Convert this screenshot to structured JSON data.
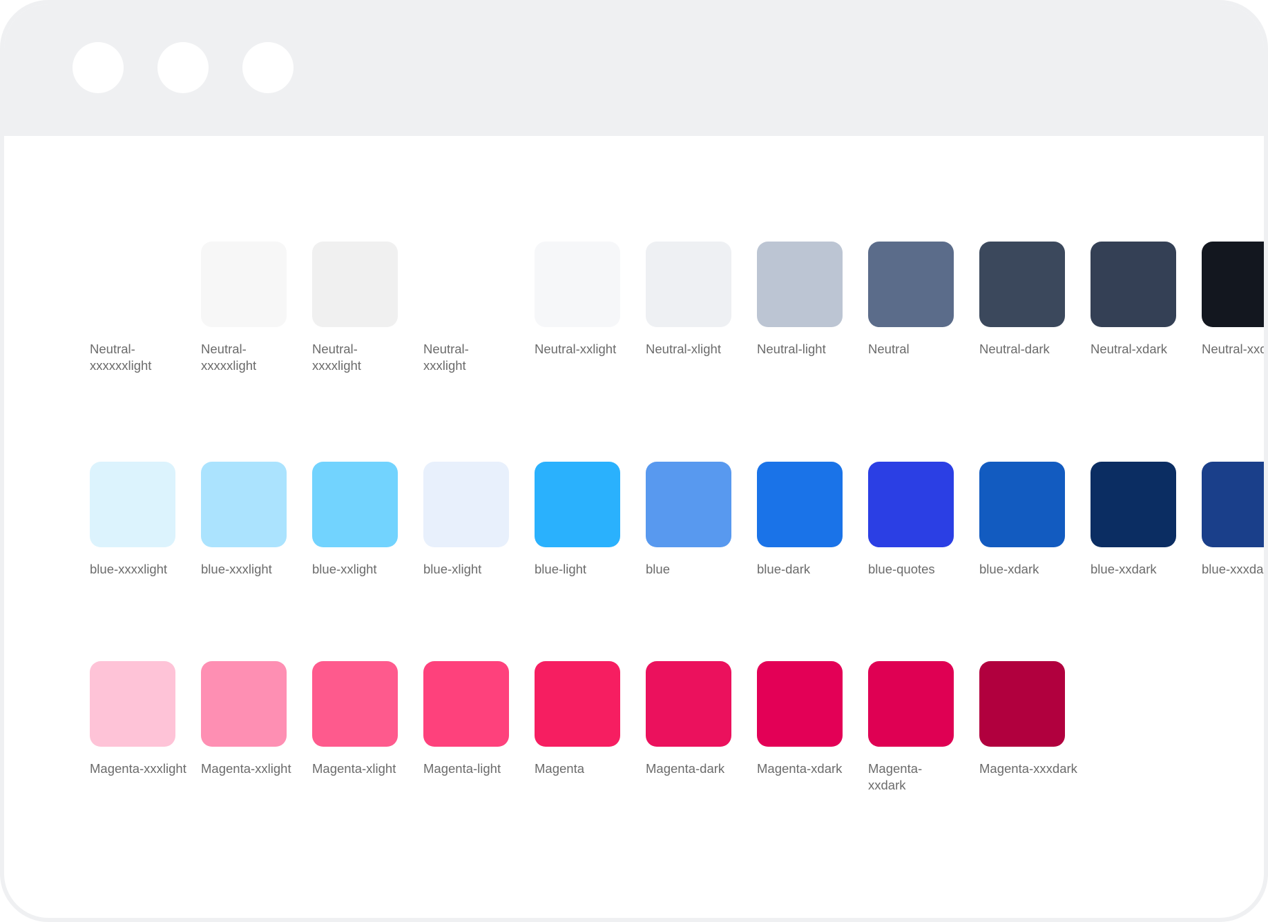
{
  "window": {
    "traffic_lights": [
      "window-dot",
      "window-dot",
      "window-dot"
    ]
  },
  "rows": [
    {
      "name": "Neutral",
      "swatches": [
        {
          "label": "Neutral-xxxxxxlight",
          "color": "#ffffff"
        },
        {
          "label": "Neutral-xxxxxlight",
          "color": "#f7f7f7"
        },
        {
          "label": "Neutral-xxxxlight",
          "color": "#f0f0f0"
        },
        {
          "label": "Neutral-xxxlight",
          "color": "#ffffff"
        },
        {
          "label": "Neutral-xxlight",
          "color": "#f6f7f9"
        },
        {
          "label": "Neutral-xlight",
          "color": "#eef0f3"
        },
        {
          "label": "Neutral-light",
          "color": "#bcc5d3"
        },
        {
          "label": "Neutral",
          "color": "#5b6c8a"
        },
        {
          "label": "Neutral-dark",
          "color": "#3b485c"
        },
        {
          "label": "Neutral-xdark",
          "color": "#344055"
        },
        {
          "label": "Neutral-xxdark",
          "color": "#13171f"
        }
      ]
    },
    {
      "name": "blue",
      "swatches": [
        {
          "label": "blue-xxxxlight",
          "color": "#dcf3fd"
        },
        {
          "label": "blue-xxxlight",
          "color": "#abe3fe"
        },
        {
          "label": "blue-xxlight",
          "color": "#72d3fe"
        },
        {
          "label": "blue-xlight",
          "color": "#e8f0fc"
        },
        {
          "label": "blue-light",
          "color": "#2ab1fd"
        },
        {
          "label": "blue",
          "color": "#5899ef"
        },
        {
          "label": "blue-dark",
          "color": "#1a73e8"
        },
        {
          "label": "blue-quotes",
          "color": "#2b3fe4"
        },
        {
          "label": "blue-xdark",
          "color": "#125bc0"
        },
        {
          "label": "blue-xxdark",
          "color": "#0b2d62"
        },
        {
          "label": "blue-xxxdark",
          "color": "#1a3f8a"
        }
      ]
    },
    {
      "name": "Magenta",
      "swatches": [
        {
          "label": "Magenta-xxxlight",
          "color": "#fec3d7"
        },
        {
          "label": "Magenta-xxlight",
          "color": "#fe8fb3"
        },
        {
          "label": "Magenta-xlight",
          "color": "#fe5a8d"
        },
        {
          "label": "Magenta-light",
          "color": "#fe417c"
        },
        {
          "label": "Magenta",
          "color": "#f61e61"
        },
        {
          "label": "Magenta-dark",
          "color": "#eb115d"
        },
        {
          "label": "Magenta-xdark",
          "color": "#e30056"
        },
        {
          "label": "Magenta-xxdark",
          "color": "#df0053"
        },
        {
          "label": "Magenta-xxxdark",
          "color": "#b1003e"
        }
      ]
    }
  ]
}
